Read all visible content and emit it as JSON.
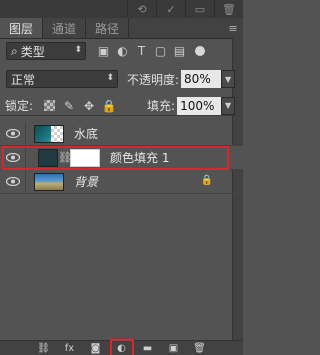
{
  "top_toolbar": {
    "icons": [
      "undo-icon",
      "check-icon",
      "folder-icon",
      "trash-icon"
    ]
  },
  "tabs": [
    {
      "label": "图层",
      "active": true
    },
    {
      "label": "通道",
      "active": false
    },
    {
      "label": "路径",
      "active": false
    }
  ],
  "filter": {
    "kind_label": "类型",
    "kind_icon": "search-icon"
  },
  "blend": {
    "mode": "正常",
    "opacity_label": "不透明度:",
    "opacity_value": "80%"
  },
  "lock": {
    "label": "锁定:",
    "fill_label": "填充:",
    "fill_value": "100%"
  },
  "layers": [
    {
      "name": "水底",
      "visible": true,
      "selected": false,
      "italic": false,
      "locked": false
    },
    {
      "name": "颜色填充 1",
      "visible": true,
      "selected": true,
      "italic": false,
      "locked": false
    },
    {
      "name": "背景",
      "visible": true,
      "selected": false,
      "italic": true,
      "locked": true
    }
  ],
  "bottom_bar": {
    "icons": [
      "link-layers-icon",
      "fx-icon",
      "mask-icon",
      "adjustment-layer-icon",
      "group-icon",
      "new-layer-icon",
      "delete-icon"
    ],
    "fx_label": "fx"
  },
  "colors": {
    "highlight": "#d9262a",
    "panel_bg": "#535353"
  }
}
